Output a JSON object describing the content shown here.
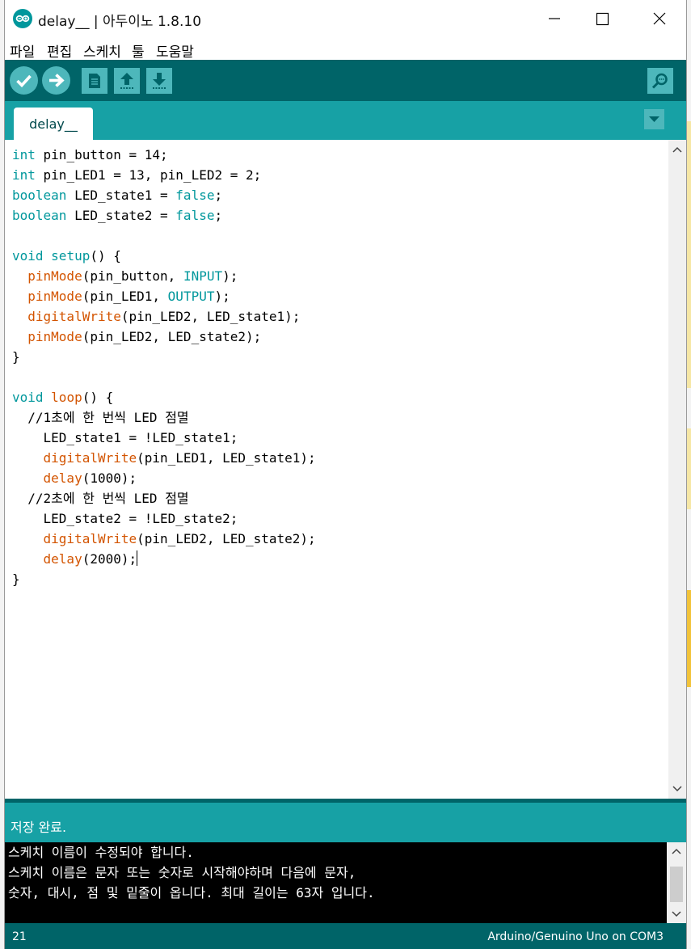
{
  "window": {
    "title": "delay__ | 아두이노 1.8.10",
    "controls": [
      "minimize",
      "maximize",
      "close"
    ]
  },
  "menu": {
    "items": [
      "파일",
      "편집",
      "스케치",
      "툴",
      "도움말"
    ]
  },
  "toolbar": {
    "buttons": [
      "verify",
      "upload",
      "new",
      "open",
      "save",
      "serial-monitor"
    ]
  },
  "tabs": [
    {
      "label": "delay__"
    }
  ],
  "editor": {
    "lines": [
      "int pin_button = 14;",
      "int pin_LED1 = 13, pin_LED2 = 2;",
      "boolean LED_state1 = false;",
      "boolean LED_state2 = false;",
      "",
      "void setup() {",
      "  pinMode(pin_button, INPUT);",
      "  pinMode(pin_LED1, OUTPUT);",
      "  digitalWrite(pin_LED2, LED_state1);",
      "  pinMode(pin_LED2, LED_state2);",
      "}",
      "",
      "void loop() {",
      "  //1초에 한 번씩 LED 점멸",
      "    LED_state1 = !LED_state1;",
      "    digitalWrite(pin_LED1, LED_state1);",
      "    delay(1000);",
      "  //2초에 한 번씩 LED 점멸",
      "    LED_state2 = !LED_state2;",
      "    digitalWrite(pin_LED2, LED_state2);",
      "    delay(2000);",
      "}"
    ]
  },
  "status": {
    "message": "저장 완료."
  },
  "console": {
    "lines": [
      "스케치 이름이 수정되야 합니다.",
      "스케치 이름은 문자 또는 숫자로 시작해야하며 다음에 문자,",
      "숫자, 대시, 점 및 밑줄이 옵니다. 최대 길이는 63자 입니다."
    ]
  },
  "footer": {
    "line_number": "21",
    "board": "Arduino/Genuino Uno on COM3"
  },
  "colors": {
    "toolbar": "#006468",
    "tabbar": "#17a1a5",
    "button": "#4db7bb",
    "keyword": "#00979c",
    "function": "#d35400"
  }
}
